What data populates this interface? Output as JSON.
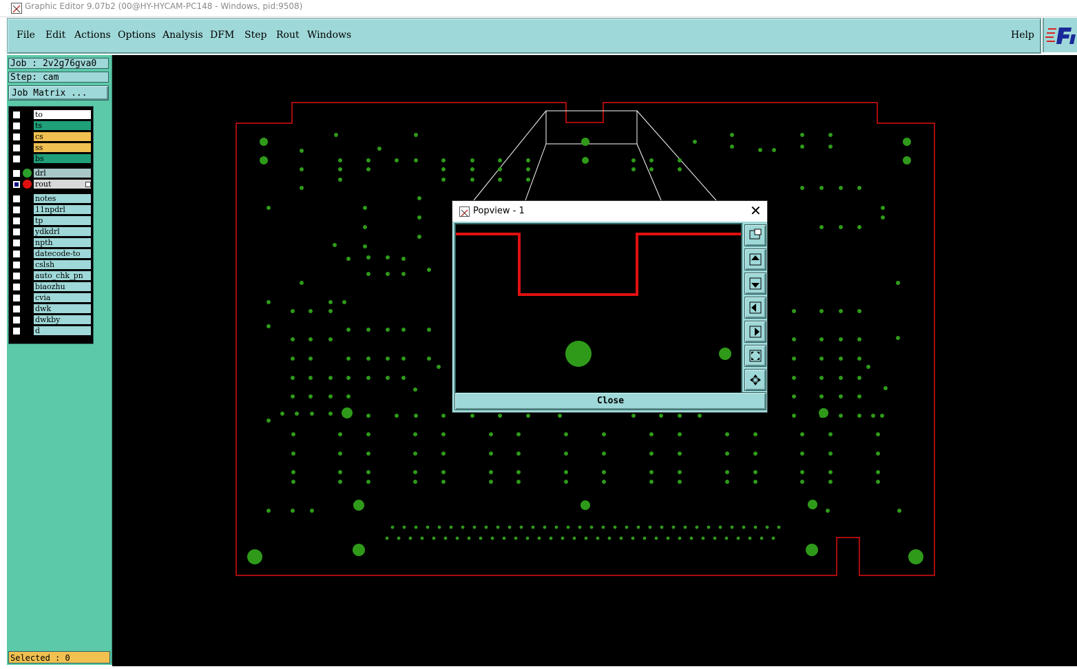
{
  "window": {
    "title": "Graphic Editor 9.07b2 (00@HY-HYCAM-PC148 - Windows, pid:9508)"
  },
  "menu": {
    "items": [
      "File",
      "Edit",
      "Actions",
      "Options",
      "Analysis",
      "DFM",
      "Step",
      "Rout",
      "Windows"
    ],
    "help": "Help"
  },
  "job": {
    "job_label": "Job : 2v2g76gva0",
    "step_label": "Step: cam",
    "matrix_button": "Job Matrix ..."
  },
  "layers": {
    "board": [
      {
        "name": "to",
        "color": "#ffffff",
        "checked": false
      },
      {
        "name": "ts",
        "color": "#1fa07a",
        "checked": false
      },
      {
        "name": "cs",
        "color": "#f0c050",
        "checked": false
      },
      {
        "name": "ss",
        "color": "#f0c050",
        "checked": false
      },
      {
        "name": "bs",
        "color": "#1fa07a",
        "checked": false
      }
    ],
    "drill": [
      {
        "name": "drl",
        "color": "#a8c8c8",
        "dot": "#2aa02a",
        "checked": false
      },
      {
        "name": "rout",
        "color": "#d8d8d8",
        "dot": "#e01010",
        "checked": true
      }
    ],
    "misc": [
      {
        "name": "notes"
      },
      {
        "name": "11npdrl"
      },
      {
        "name": "tp"
      },
      {
        "name": "ydkdrl"
      },
      {
        "name": "npth"
      },
      {
        "name": "datecode-to"
      },
      {
        "name": "cslsh"
      },
      {
        "name": "auto_chk_pn"
      },
      {
        "name": "biaozhu"
      },
      {
        "name": "cvia"
      },
      {
        "name": "dwk"
      },
      {
        "name": "dwkby"
      },
      {
        "name": "d"
      }
    ]
  },
  "status": {
    "selected": "Selected : 0"
  },
  "popview": {
    "title": "Popview - 1",
    "close_button": "Close",
    "tools": [
      "zoom-window-icon",
      "pan-up-icon",
      "pan-down-icon",
      "pan-left-icon",
      "pan-right-icon",
      "zoom-home-icon",
      "zoom-center-icon"
    ]
  },
  "colors": {
    "accent": "#9fd8d8",
    "sidebar": "#5cc9a9",
    "profile": "#e01010",
    "pads": "#2f9a1a",
    "canvas": "#000000"
  }
}
